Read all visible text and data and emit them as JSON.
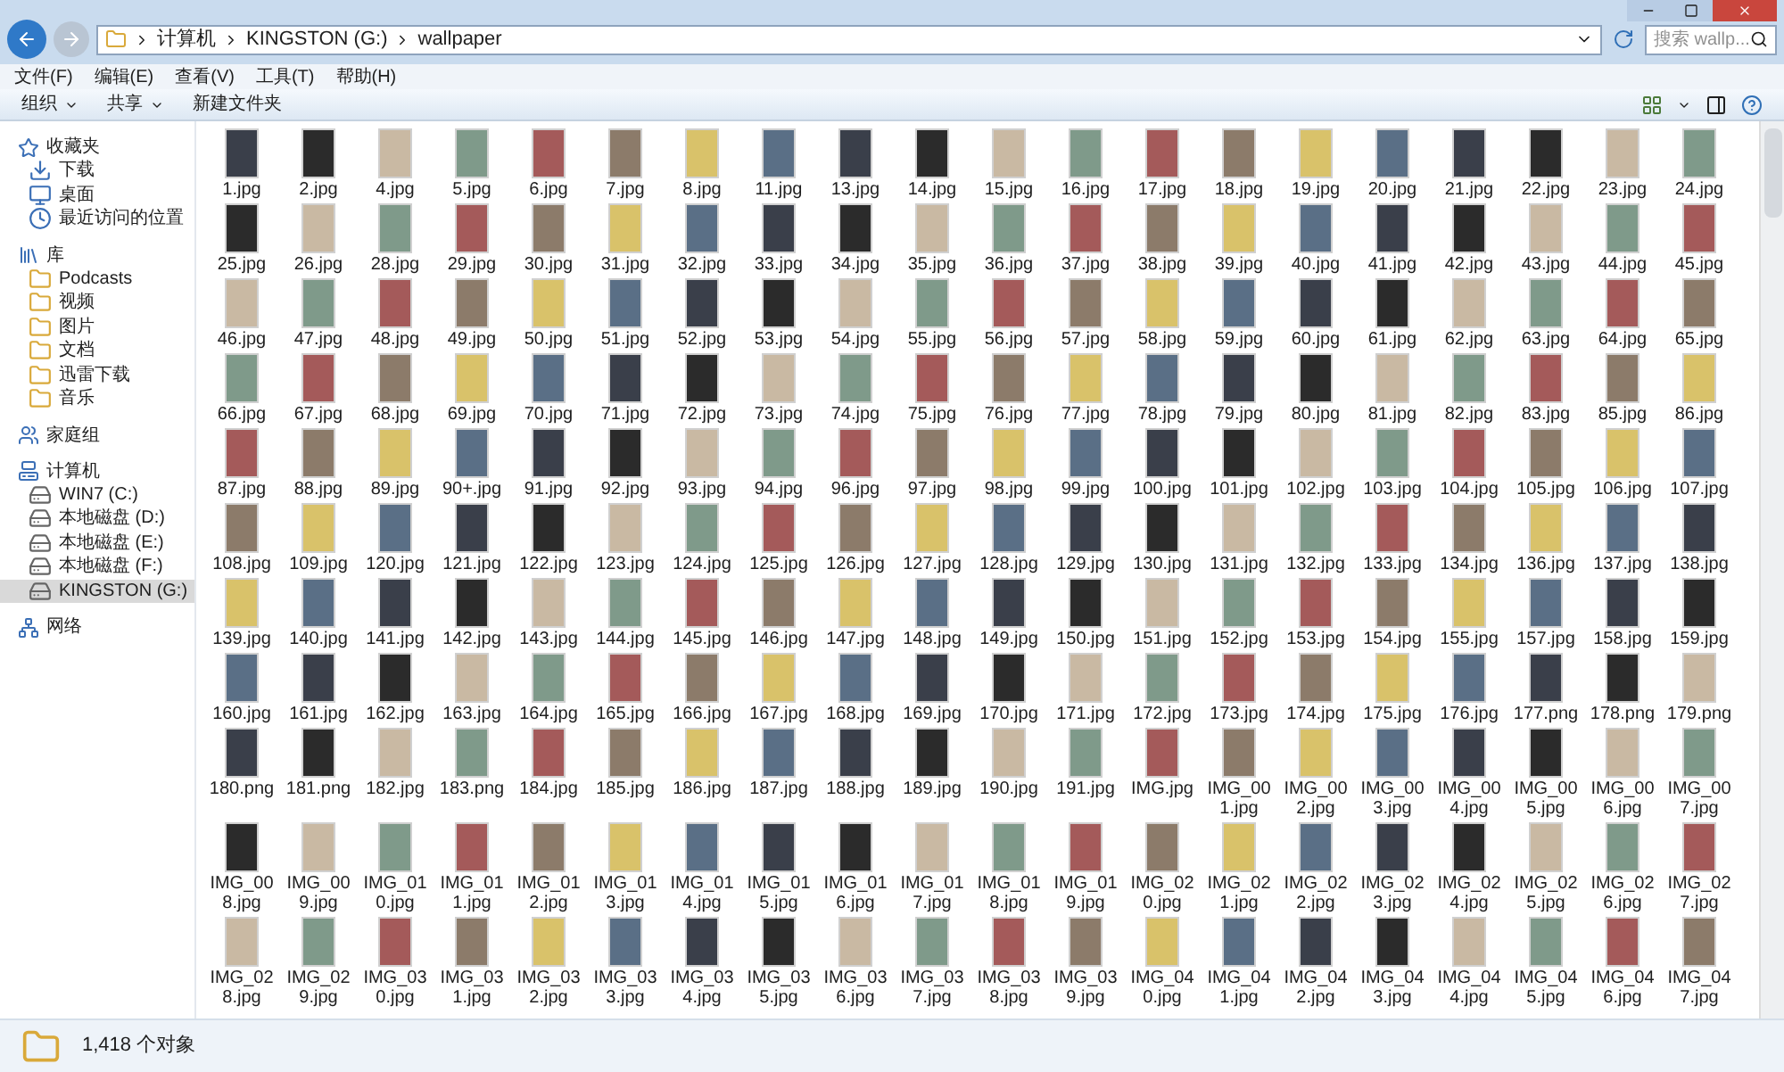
{
  "address": {
    "path": [
      "计算机",
      "KINGSTON (G:)",
      "wallpaper"
    ]
  },
  "search": {
    "placeholder": "搜索 wallp..."
  },
  "menu": [
    "文件(F)",
    "编辑(E)",
    "查看(V)",
    "工具(T)",
    "帮助(H)"
  ],
  "toolbar": [
    {
      "label": "组织",
      "kind": "dropdown"
    },
    {
      "label": "共享",
      "kind": "dropdown"
    },
    {
      "label": "新建文件夹",
      "kind": "button"
    }
  ],
  "sidebar": [
    {
      "label": "收藏夹",
      "selected": false,
      "children": [
        {
          "label": "下载",
          "selected": false
        },
        {
          "label": "桌面",
          "selected": false
        },
        {
          "label": "最近访问的位置",
          "selected": false
        }
      ]
    },
    {
      "label": "库",
      "selected": false,
      "children": [
        {
          "label": "Podcasts",
          "selected": false
        },
        {
          "label": "视频",
          "selected": false
        },
        {
          "label": "图片",
          "selected": false
        },
        {
          "label": "文档",
          "selected": false
        },
        {
          "label": "迅雷下载",
          "selected": false
        },
        {
          "label": "音乐",
          "selected": false
        }
      ]
    },
    {
      "label": "家庭组",
      "selected": false
    },
    {
      "label": "计算机",
      "selected": false,
      "children": [
        {
          "label": "WIN7 (C:)",
          "selected": false
        },
        {
          "label": "本地磁盘 (D:)",
          "selected": false
        },
        {
          "label": "本地磁盘 (E:)",
          "selected": false
        },
        {
          "label": "本地磁盘 (F:)",
          "selected": false
        },
        {
          "label": "KINGSTON (G:)",
          "selected": true
        }
      ]
    },
    {
      "label": "网络",
      "selected": false
    }
  ],
  "files": [
    "1.jpg",
    "2.jpg",
    "4.jpg",
    "5.jpg",
    "6.jpg",
    "7.jpg",
    "8.jpg",
    "11.jpg",
    "13.jpg",
    "14.jpg",
    "15.jpg",
    "16.jpg",
    "17.jpg",
    "18.jpg",
    "19.jpg",
    "20.jpg",
    "21.jpg",
    "22.jpg",
    "23.jpg",
    "24.jpg",
    "25.jpg",
    "26.jpg",
    "28.jpg",
    "29.jpg",
    "30.jpg",
    "31.jpg",
    "32.jpg",
    "33.jpg",
    "34.jpg",
    "35.jpg",
    "36.jpg",
    "37.jpg",
    "38.jpg",
    "39.jpg",
    "40.jpg",
    "41.jpg",
    "42.jpg",
    "43.jpg",
    "44.jpg",
    "45.jpg",
    "46.jpg",
    "47.jpg",
    "48.jpg",
    "49.jpg",
    "50.jpg",
    "51.jpg",
    "52.jpg",
    "53.jpg",
    "54.jpg",
    "55.jpg",
    "56.jpg",
    "57.jpg",
    "58.jpg",
    "59.jpg",
    "60.jpg",
    "61.jpg",
    "62.jpg",
    "63.jpg",
    "64.jpg",
    "65.jpg",
    "66.jpg",
    "67.jpg",
    "68.jpg",
    "69.jpg",
    "70.jpg",
    "71.jpg",
    "72.jpg",
    "73.jpg",
    "74.jpg",
    "75.jpg",
    "76.jpg",
    "77.jpg",
    "78.jpg",
    "79.jpg",
    "80.jpg",
    "81.jpg",
    "82.jpg",
    "83.jpg",
    "85.jpg",
    "86.jpg",
    "87.jpg",
    "88.jpg",
    "89.jpg",
    "90+.jpg",
    "91.jpg",
    "92.jpg",
    "93.jpg",
    "94.jpg",
    "96.jpg",
    "97.jpg",
    "98.jpg",
    "99.jpg",
    "100.jpg",
    "101.jpg",
    "102.jpg",
    "103.jpg",
    "104.jpg",
    "105.jpg",
    "106.jpg",
    "107.jpg",
    "108.jpg",
    "109.jpg",
    "120.jpg",
    "121.jpg",
    "122.jpg",
    "123.jpg",
    "124.jpg",
    "125.jpg",
    "126.jpg",
    "127.jpg",
    "128.jpg",
    "129.jpg",
    "130.jpg",
    "131.jpg",
    "132.jpg",
    "133.jpg",
    "134.jpg",
    "136.jpg",
    "137.jpg",
    "138.jpg",
    "139.jpg",
    "140.jpg",
    "141.jpg",
    "142.jpg",
    "143.jpg",
    "144.jpg",
    "145.jpg",
    "146.jpg",
    "147.jpg",
    "148.jpg",
    "149.jpg",
    "150.jpg",
    "151.jpg",
    "152.jpg",
    "153.jpg",
    "154.jpg",
    "155.jpg",
    "157.jpg",
    "158.jpg",
    "159.jpg",
    "160.jpg",
    "161.jpg",
    "162.jpg",
    "163.jpg",
    "164.jpg",
    "165.jpg",
    "166.jpg",
    "167.jpg",
    "168.jpg",
    "169.jpg",
    "170.jpg",
    "171.jpg",
    "172.jpg",
    "173.jpg",
    "174.jpg",
    "175.jpg",
    "176.jpg",
    "177.png",
    "178.png",
    "179.png",
    "180.png",
    "181.png",
    "182.jpg",
    "183.png",
    "184.jpg",
    "185.jpg",
    "186.jpg",
    "187.jpg",
    "188.jpg",
    "189.jpg",
    "190.jpg",
    "191.jpg",
    "IMG.jpg",
    "IMG_001.jpg",
    "IMG_002.jpg",
    "IMG_003.jpg",
    "IMG_004.jpg",
    "IMG_005.jpg",
    "IMG_006.jpg",
    "IMG_007.jpg",
    "IMG_008.jpg",
    "IMG_009.jpg",
    "IMG_010.jpg",
    "IMG_011.jpg",
    "IMG_012.jpg",
    "IMG_013.jpg",
    "IMG_014.jpg",
    "IMG_015.jpg",
    "IMG_016.jpg",
    "IMG_017.jpg",
    "IMG_018.jpg",
    "IMG_019.jpg",
    "IMG_020.jpg",
    "IMG_021.jpg",
    "IMG_022.jpg",
    "IMG_023.jpg",
    "IMG_024.jpg",
    "IMG_025.jpg",
    "IMG_026.jpg",
    "IMG_027.jpg",
    "IMG_028.jpg",
    "IMG_029.jpg",
    "IMG_030.jpg",
    "IMG_031.jpg",
    "IMG_032.jpg",
    "IMG_033.jpg",
    "IMG_034.jpg",
    "IMG_035.jpg",
    "IMG_036.jpg",
    "IMG_037.jpg",
    "IMG_038.jpg",
    "IMG_039.jpg",
    "IMG_040.jpg",
    "IMG_041.jpg",
    "IMG_042.jpg",
    "IMG_043.jpg",
    "IMG_044.jpg",
    "IMG_045.jpg",
    "IMG_046.jpg",
    "IMG_047.jpg"
  ],
  "status_bar": {
    "count": "1,418 个对象"
  }
}
